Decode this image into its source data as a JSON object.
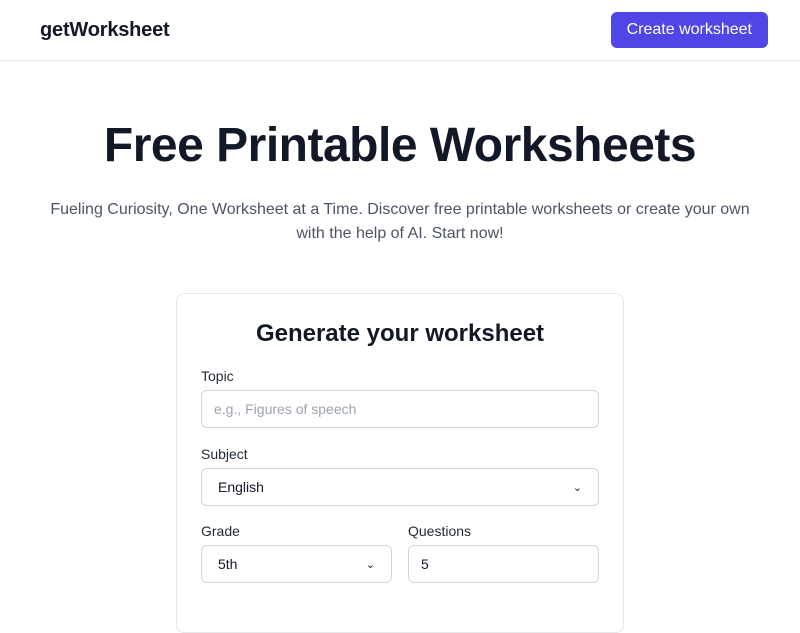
{
  "header": {
    "logo": "getWorksheet",
    "cta_label": "Create worksheet"
  },
  "hero": {
    "title": "Free Printable Worksheets",
    "subtitle": "Fueling Curiosity, One Worksheet at a Time. Discover free printable worksheets or create your own with the help of AI. Start now!"
  },
  "form": {
    "title": "Generate your worksheet",
    "topic": {
      "label": "Topic",
      "value": "",
      "placeholder": "e.g., Figures of speech"
    },
    "subject": {
      "label": "Subject",
      "selected": "English"
    },
    "grade": {
      "label": "Grade",
      "selected": "5th"
    },
    "questions": {
      "label": "Questions",
      "value": "5"
    }
  },
  "icons": {
    "select_arrow": "chevron-down-icon"
  },
  "colors": {
    "accent": "#4f46e5",
    "border": "#e5e7eb",
    "muted_text": "#4b5563"
  }
}
